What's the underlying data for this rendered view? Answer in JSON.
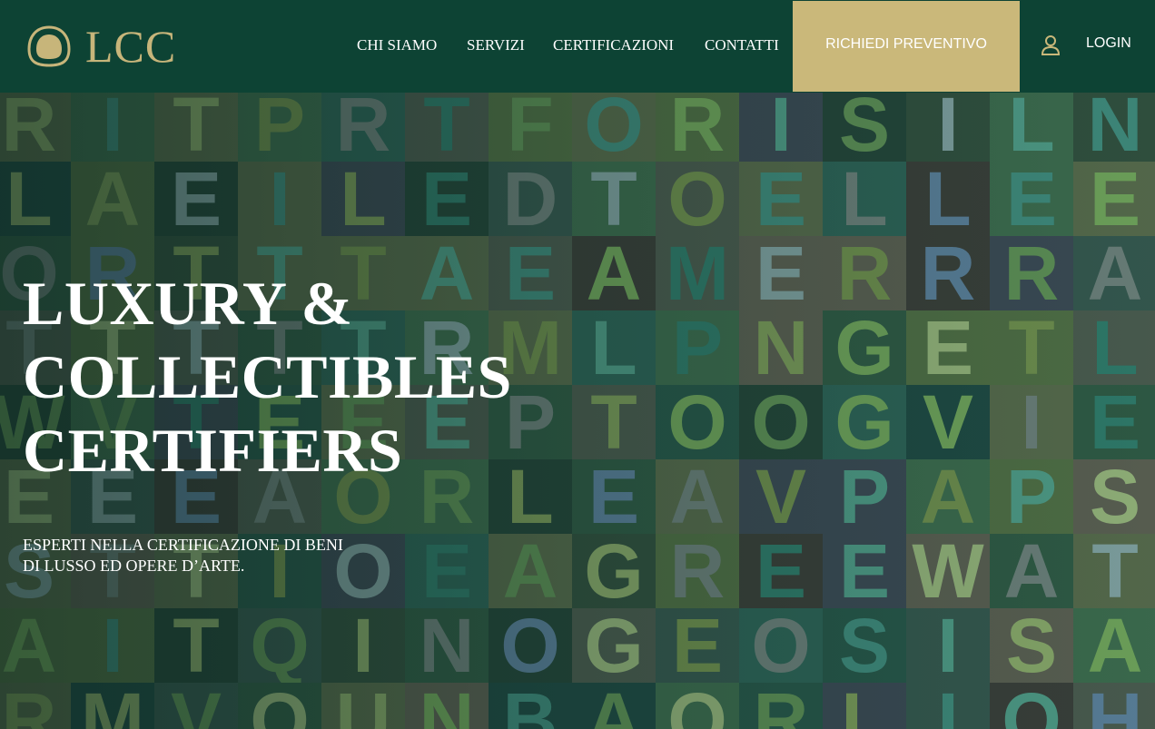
{
  "brand": {
    "logo_text": "LCC",
    "accent_color": "#cab87a",
    "header_color": "#0d4334"
  },
  "nav": {
    "items": [
      {
        "label": "CHI SIAMO"
      },
      {
        "label": "SERVIZI"
      },
      {
        "label": "CERTIFICAZIONI"
      },
      {
        "label": "CONTATTI"
      }
    ],
    "cta_label": "RICHIEDI PREVENTIVO",
    "login_label": "LOGIN",
    "user_icon": "user-icon"
  },
  "hero": {
    "title_lines": [
      "LUXURY &",
      "COLLECTIBLES",
      "CERTIFIERS"
    ],
    "subtitle_lines": [
      "ESPERTI NELLA CERTIFICAZIONE DI BENI",
      "DI LUSSO ED OPERE D’ARTE."
    ],
    "background_letters": [
      "RITPRTFORISILNIII",
      "LAEILEDTOELLEEC",
      "ORTTTAEAMERRRA",
      "TTTTTRMLPNGETL",
      "WVTEEEPTOOGVIE",
      "EEEAORLEAVPAPS",
      "STTIOEAGREEWAT",
      "AITQINOGEOSISAKA",
      "RMVOUNBAORLIOHRIN"
    ]
  }
}
